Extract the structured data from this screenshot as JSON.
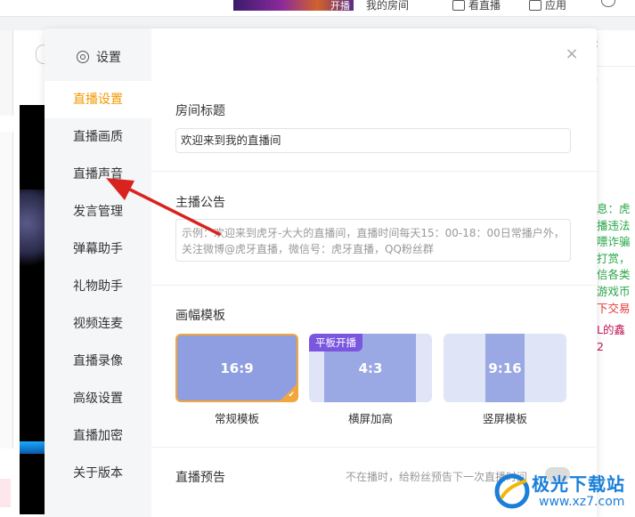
{
  "background": {
    "top_nav": [
      "我的房间",
      "看直播",
      "应用"
    ],
    "banner_text": "开播",
    "chat_green": [
      "息：虎",
      "播违法",
      "嘌诈骗",
      "打赏，",
      "信各类",
      "游戏币",
      "下交易"
    ],
    "chat_pink": [
      "L的鑫",
      "2"
    ]
  },
  "dialog": {
    "title": "设置",
    "close_label": "×",
    "nav": [
      "直播设置",
      "直播画质",
      "直播声音",
      "发言管理",
      "弹幕助手",
      "礼物助手",
      "视频连麦",
      "直播录像",
      "高级设置",
      "直播加密",
      "关于版本"
    ],
    "room_title": {
      "label": "房间标题",
      "value": "欢迎来到我的直播间"
    },
    "notice": {
      "label": "主播公告",
      "placeholder": "示例：欢迎来到虎牙-大大的直播间，直播时间每天15：00-18：00日常播户外，关注微博@虎牙直播，微信号：虎牙直播，QQ粉丝群"
    },
    "templates": {
      "label": "画幅模板",
      "items": [
        {
          "ratio": "16:9",
          "name": "常规模板",
          "selected": true
        },
        {
          "ratio": "4:3",
          "name": "横屏加高",
          "badge": "平板开播"
        },
        {
          "ratio": "9:16",
          "name": "竖屏模板"
        }
      ]
    },
    "preview": {
      "label": "直播预告",
      "hint": "不在播时，给粉丝预告下一次直播时间"
    }
  },
  "watermark": {
    "name": "极光下载站",
    "url": "www.xz7.com"
  },
  "colors": {
    "accent": "#f39800",
    "template_blue": "#8e9ee0",
    "badge_purple": "#7b57e0",
    "arrow_red": "#d9231f"
  }
}
